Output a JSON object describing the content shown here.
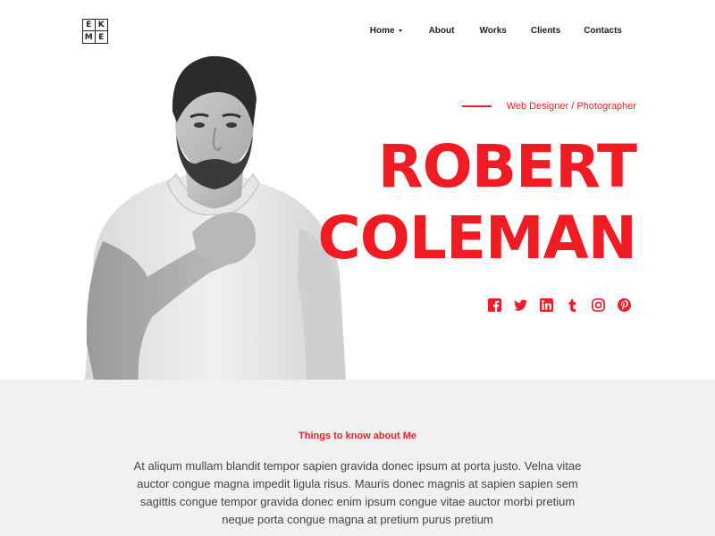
{
  "logo": {
    "letters": [
      "E",
      "K",
      "M",
      "E"
    ]
  },
  "nav": {
    "items": [
      {
        "label": "Home",
        "has_dropdown": true
      },
      {
        "label": "About"
      },
      {
        "label": "Works"
      },
      {
        "label": "Clients"
      },
      {
        "label": "Contacts"
      }
    ]
  },
  "hero": {
    "subtitle": "Web Designer / Photographer",
    "name_line1": "ROBERT",
    "name_line2": "COLEMAN",
    "photo": "portrait-photo",
    "social": [
      "facebook-icon",
      "twitter-icon",
      "linkedin-icon",
      "tumblr-icon",
      "instagram-icon",
      "pinterest-icon"
    ]
  },
  "about": {
    "title": "Things to know about Me",
    "text": "At aliqum mullam blandit tempor sapien gravida donec ipsum at porta justo. Velna vitae auctor congue magna impedit ligula risus. Mauris donec magnis at sapien sapien sem sagittis congue tempor gravida donec enim ipsum congue vitae auctor morbi pretium neque porta congue magna at pretium purus pretium"
  },
  "colors": {
    "accent": "#ee1c24",
    "section_bg": "#f1f1f1",
    "text": "#222222"
  }
}
